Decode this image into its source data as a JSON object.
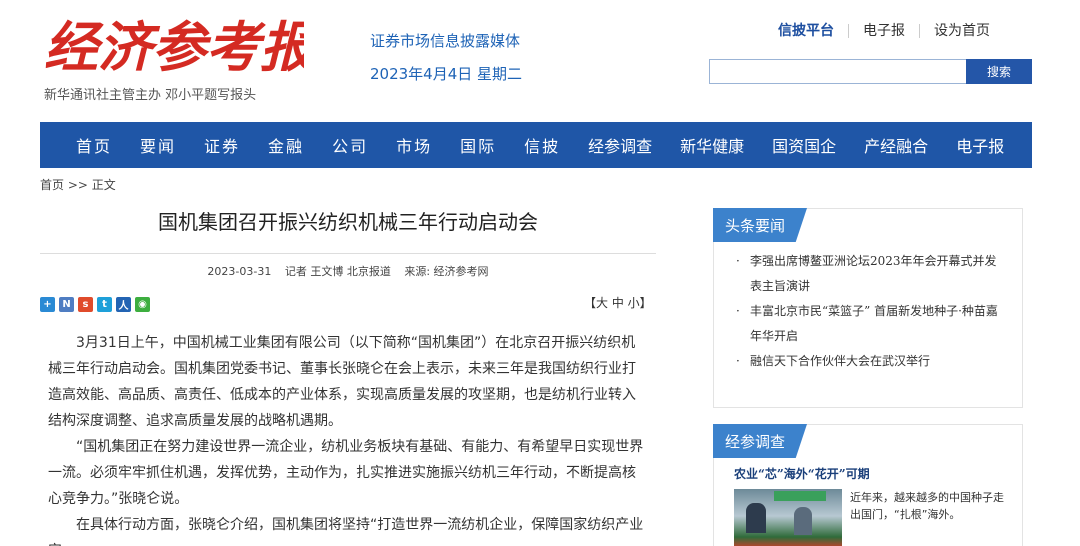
{
  "header": {
    "logo_text": "经济参考报",
    "slogan": "新华通讯社主管主办 邓小平题写报头",
    "tagline": "证券市场信息披露媒体",
    "date": "2023年4月4日 星期二",
    "links": [
      "信披平台",
      "电子报",
      "设为首页"
    ],
    "search_value": "",
    "search_button": "搜索"
  },
  "nav": [
    "首页",
    "要闻",
    "证券",
    "金融",
    "公司",
    "市场",
    "国际",
    "信披",
    "经参调查",
    "新华健康",
    "国资国企",
    "产经融合",
    "电子报"
  ],
  "breadcrumb": "首页 >> 正文",
  "article": {
    "title": "国机集团召开振兴纺织机械三年行动启动会",
    "date": "2023-03-31",
    "reporter": "记者 王文博 北京报道",
    "source": "来源: 经济参考网",
    "fontsize_label": "【大 中 小】",
    "share_icons": [
      "qzone-share-icon",
      "weibo-share-icon",
      "sina-share-icon",
      "tencent-share-icon",
      "renren-share-icon",
      "wechat-share-icon"
    ],
    "paragraphs": [
      "3月31日上午，中国机械工业集团有限公司（以下简称“国机集团”）在北京召开振兴纺织机械三年行动启动会。国机集团党委书记、董事长张晓仑在会上表示，未来三年是我国纺织行业打造高效能、高品质、高责任、低成本的产业体系，实现高质量发展的攻坚期，也是纺机行业转入结构深度调整、追求高质量发展的战略机遇期。",
      "“国机集团正在努力建设世界一流企业，纺机业务板块有基础、有能力、有希望早日实现世界一流。必须牢牢抓住机遇，发挥优势，主动作为，扎实推进实施振兴纺机三年行动，不断提高核心竞争力。”张晓仑说。",
      "在具体行动方面，张晓仑介绍，国机集团将坚持“打造世界一流纺机企业，保障国家纺织产业安"
    ]
  },
  "sidebar": {
    "headlines_tab": "头条要闻",
    "headlines": [
      "李强出席博鳌亚洲论坛2023年年会开幕式并发表主旨演讲",
      "丰富北京市民“菜篮子” 首届新发地种子·种苗嘉年华开启",
      "融信天下合作伙伴大会在武汉举行"
    ],
    "survey_tab": "经参调查",
    "survey_title": "农业“芯”海外“花开”可期",
    "survey_summary": "近年来，越来越多的中国种子走出国门，“扎根”海外。"
  }
}
